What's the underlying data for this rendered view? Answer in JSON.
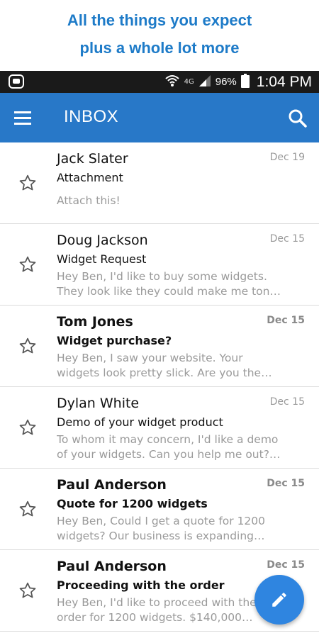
{
  "promo": {
    "line1": "All the things you expect",
    "line2": "plus a whole lot more"
  },
  "status_bar": {
    "network": "4G",
    "battery": "96%",
    "time": "1:04 PM"
  },
  "app_bar": {
    "title": "INBOX",
    "menu_icon": "menu-icon",
    "search_icon": "search-icon"
  },
  "emails": [
    {
      "sender": "Jack Slater",
      "subject": "Attachment",
      "preview_line1": "Attach this!",
      "preview_line2": "",
      "date": "Dec 19",
      "unread": false
    },
    {
      "sender": "Doug Jackson",
      "subject": "Widget Request",
      "preview_line1": "Hey Ben, I'd like to buy some widgets.",
      "preview_line2": "They look like they could make me ton…",
      "date": "Dec 15",
      "unread": false
    },
    {
      "sender": "Tom Jones",
      "subject": "Widget purchase?",
      "preview_line1": "Hey Ben, I saw your website. Your",
      "preview_line2": "widgets look pretty slick. Are you the…",
      "date": "Dec 15",
      "unread": true
    },
    {
      "sender": "Dylan White",
      "subject": "Demo of your widget product",
      "preview_line1": "To whom it may concern, I'd like a demo",
      "preview_line2": "of your widgets. Can you help me out?…",
      "date": "Dec 15",
      "unread": false
    },
    {
      "sender": "Paul Anderson",
      "subject": "Quote for 1200 widgets",
      "preview_line1": "Hey Ben, Could I get a quote for 1200",
      "preview_line2": "widgets? Our business is expanding…",
      "date": "Dec 15",
      "unread": true
    },
    {
      "sender": "Paul Anderson",
      "subject": "Proceeding with the order",
      "preview_line1": "Hey Ben, I'd like to proceed with the",
      "preview_line2": "order for 1200 widgets. $140,000…",
      "date": "Dec 15",
      "unread": true
    }
  ],
  "fab": {
    "icon": "pencil-icon"
  },
  "colors": {
    "promo_text": "#1e7bc8",
    "app_bar": "#2878c8",
    "fab": "#2f85e0",
    "status_bar": "#1a1a1a"
  }
}
